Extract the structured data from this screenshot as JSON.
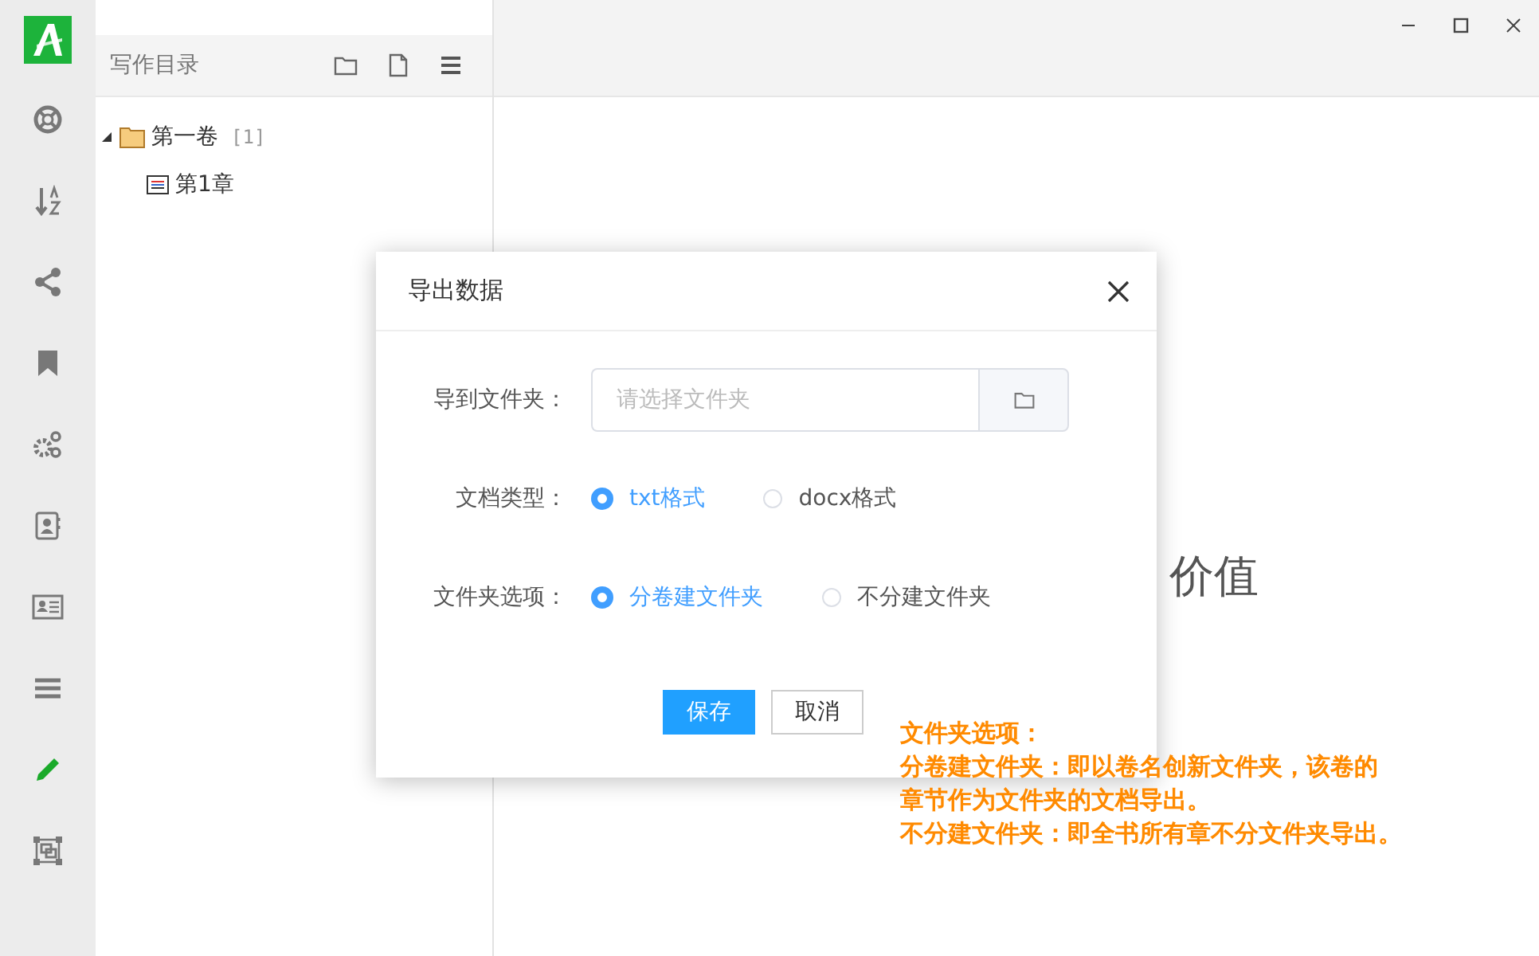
{
  "sidebar_icons": [
    {
      "kind": "lifebuoy",
      "selected": false
    },
    {
      "kind": "sort",
      "selected": false
    },
    {
      "kind": "share",
      "selected": false
    },
    {
      "kind": "bookmark",
      "selected": false
    },
    {
      "kind": "gears",
      "selected": false
    },
    {
      "kind": "contacts",
      "selected": false
    },
    {
      "kind": "id-card",
      "selected": false
    },
    {
      "kind": "menu",
      "selected": false
    },
    {
      "kind": "pencil",
      "selected": true
    },
    {
      "kind": "frame",
      "selected": false
    }
  ],
  "outline": {
    "title": "写作目录",
    "tree": [
      {
        "label": "第一卷",
        "count": "[1]",
        "expanded": true,
        "children": [
          {
            "label": "第1章"
          }
        ]
      }
    ]
  },
  "main_text": "价值",
  "dialog": {
    "title": "导出数据",
    "folder_field": {
      "label": "导到文件夹：",
      "placeholder": "请选择文件夹"
    },
    "radio_groups": [
      {
        "label": "文档类型：",
        "options": [
          {
            "label": "txt格式",
            "selected": true
          },
          {
            "label": "docx格式",
            "selected": false
          }
        ]
      },
      {
        "label": "文件夹选项：",
        "options": [
          {
            "label": "分卷建文件夹",
            "selected": true
          },
          {
            "label": "不分建文件夹",
            "selected": false
          }
        ]
      }
    ],
    "buttons": [
      {
        "label": "保存",
        "kind": "primary"
      },
      {
        "label": "取消",
        "kind": "default"
      }
    ]
  },
  "annotation": [
    "文件夹选项：",
    "分卷建文件夹：即以卷名创新文件夹，该卷的",
    "章节作为文件夹的文档导出。",
    "不分建文件夹：即全书所有章不分文件夹导出。"
  ]
}
